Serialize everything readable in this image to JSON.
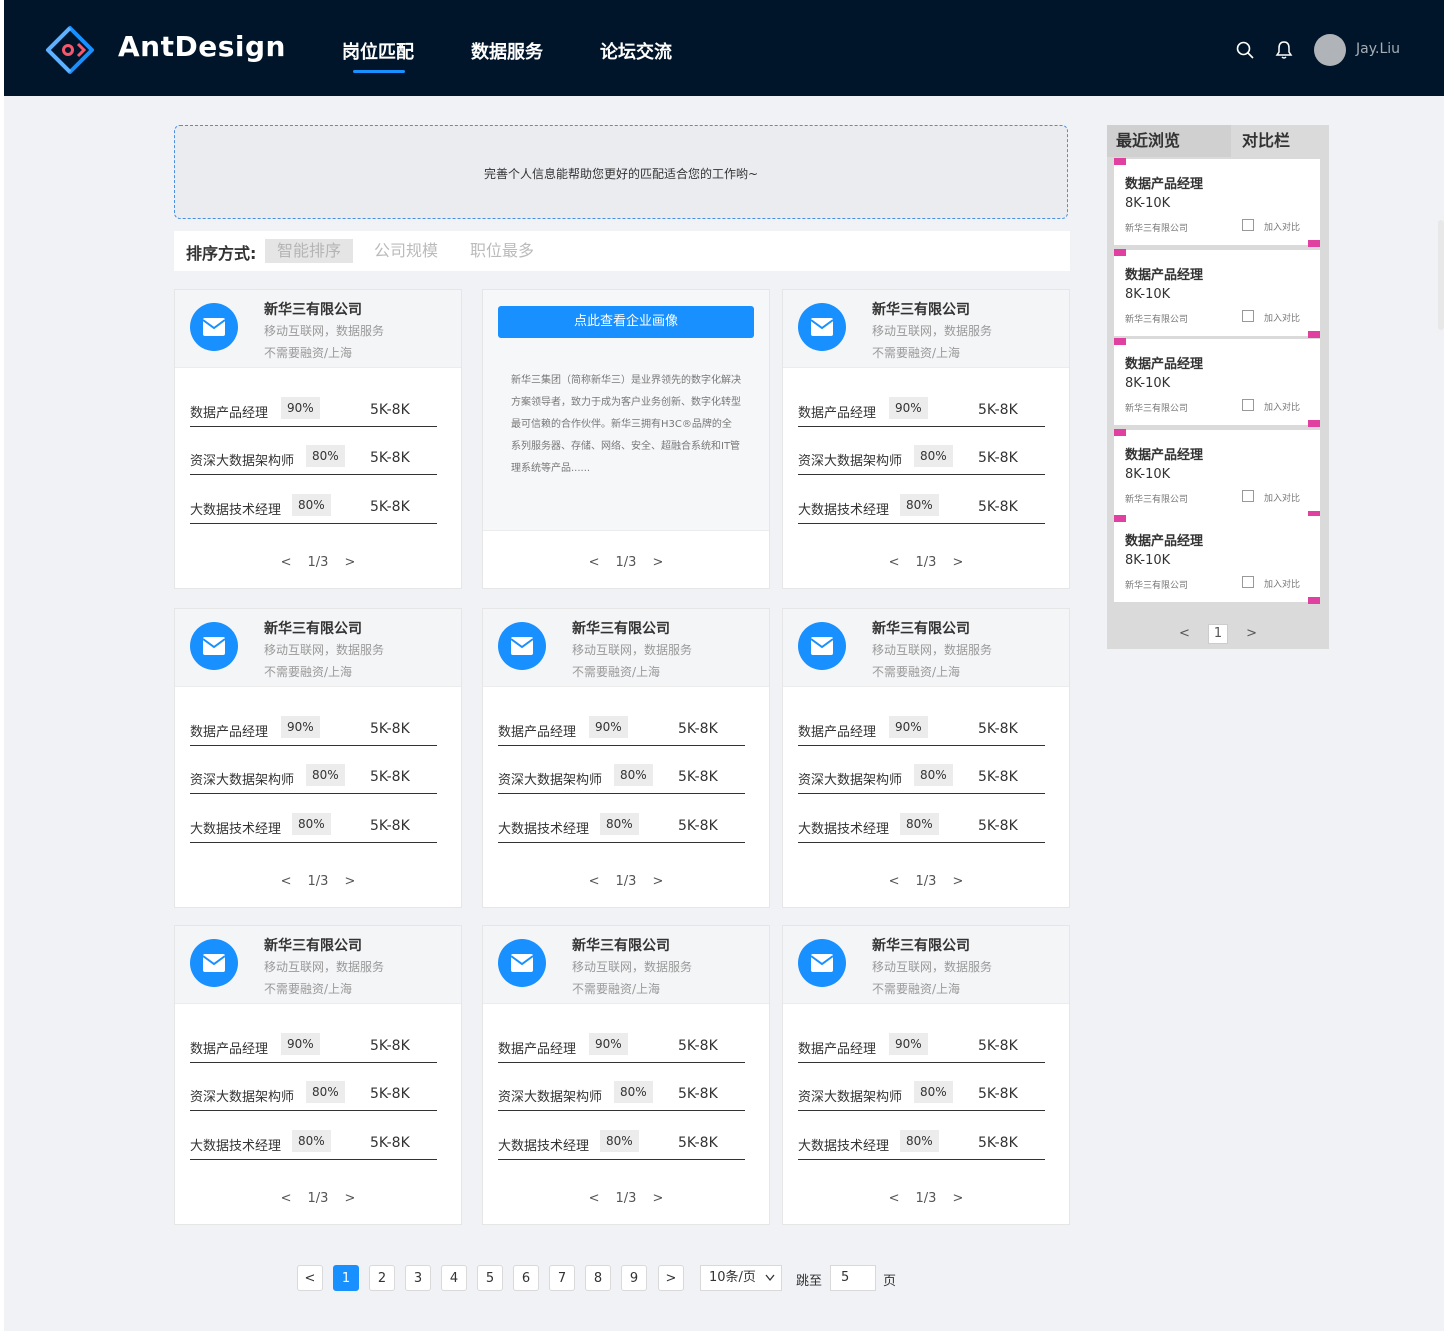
{
  "app": {
    "brand": "AntDesign",
    "username": "Jay.Liu"
  },
  "nav": [
    {
      "label": "岗位匹配"
    },
    {
      "label": "数据服务"
    },
    {
      "label": "论坛交流"
    }
  ],
  "colors": {
    "header_bg": "#001529",
    "accent": "#1890ff",
    "tag": "#e040a0"
  },
  "icons": {
    "logo": "antdesign-logo",
    "search": "search-icon",
    "bell": "bell-icon",
    "company": "mail-icon"
  },
  "banner": {
    "text": "完善个人信息能帮助您更好的匹配适合您的工作哟~"
  },
  "sort": {
    "label": "排序方式:",
    "options": [
      "智能排序",
      "公司规模",
      "职位最多"
    ],
    "selected": "智能排序"
  },
  "company": {
    "name": "新华三有限公司",
    "industry": "移动互联网，数据服务",
    "funding": "不需要融资/上海"
  },
  "jobs": [
    {
      "title": "数据产品经理",
      "match": "90%",
      "salary": "5K-8K"
    },
    {
      "title": "资深大数据架构师",
      "match": "80%",
      "salary": "5K-8K"
    },
    {
      "title": "大数据技术经理",
      "match": "80%",
      "salary": "5K-8K"
    }
  ],
  "card_pager": {
    "prev": "<",
    "page": "1/3",
    "next": ">"
  },
  "featured": {
    "button": "点此查看企业画像",
    "description": "新华三集团（简称新华三）是业界领先的数字化解决方案领导者，致力于成为客户业务创新、数字化转型最可信赖的合作伙伴。新华三拥有H3C®品牌的全系列服务器、存储、网络、安全、超融合系统和IT管理系统等产品......"
  },
  "pagination": {
    "prev": "<",
    "pages": [
      "1",
      "2",
      "3",
      "4",
      "5",
      "6",
      "7",
      "8",
      "9"
    ],
    "current": "1",
    "next": ">",
    "page_size": "10条/页",
    "goto_label": "跳至",
    "goto_value": "5",
    "page_unit": "页"
  },
  "sidebar": {
    "tabs": [
      "最近浏览",
      "对比栏"
    ],
    "active_tab": "最近浏览",
    "item": {
      "title": "数据产品经理",
      "salary": "8K-10K",
      "company": "新华三有限公司",
      "compare_label": "加入对比"
    },
    "item_count": 5,
    "pager": {
      "prev": "<",
      "page": "1",
      "next": ">"
    }
  }
}
